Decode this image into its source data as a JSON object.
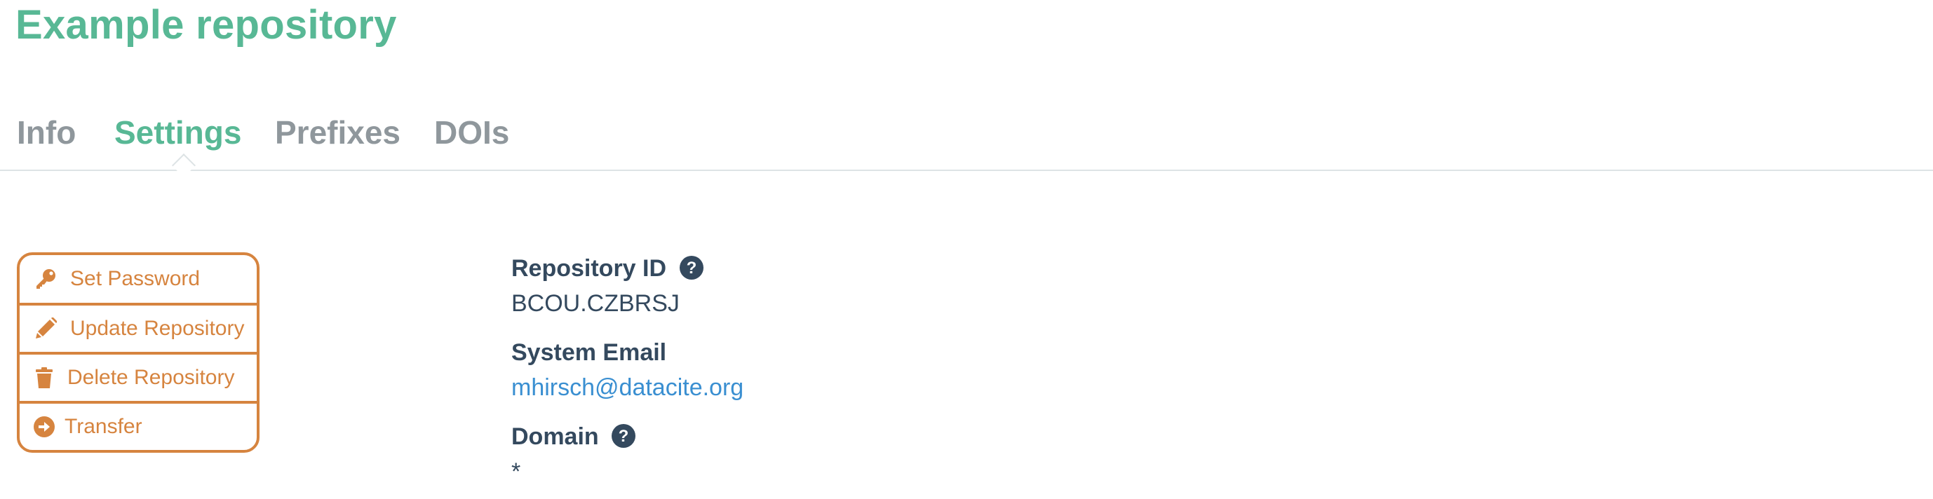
{
  "page": {
    "title": "Example repository"
  },
  "tabs": [
    {
      "label": "Info",
      "active": false
    },
    {
      "label": "Settings",
      "active": true
    },
    {
      "label": "Prefixes",
      "active": false
    },
    {
      "label": "DOIs",
      "active": false
    }
  ],
  "actions": [
    {
      "label": "Set Password",
      "icon": "key-icon"
    },
    {
      "label": "Update Repository",
      "icon": "pencil-icon"
    },
    {
      "label": "Delete Repository",
      "icon": "trash-icon"
    },
    {
      "label": "Transfer",
      "icon": "arrow-circle-right-icon"
    }
  ],
  "details": {
    "repository_id": {
      "label": "Repository ID",
      "value": "BCOU.CZBRSJ",
      "help_icon": "question-circle-icon"
    },
    "system_email": {
      "label": "System Email",
      "value": "mhirsch@datacite.org"
    },
    "domain": {
      "label": "Domain",
      "value": "*",
      "help_icon": "question-circle-icon"
    }
  },
  "colors": {
    "title": "#58b895",
    "tab_inactive": "#8f979c",
    "tab_active": "#58b895",
    "action_accent": "#d6843f",
    "text": "#34495e",
    "link": "#3a8fd1"
  }
}
